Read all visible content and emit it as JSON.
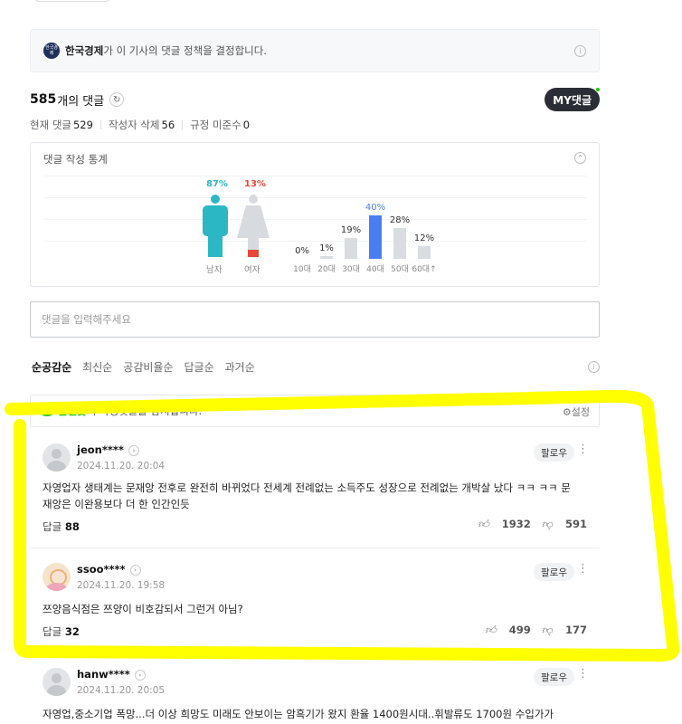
{
  "policy": {
    "press_logo_text": "한국경제",
    "press_name": "한국경제",
    "text": "가 이 기사의 댓글 정책을 결정합니다."
  },
  "comments_header": {
    "count": "585",
    "count_label": "개의 댓글",
    "my_button": "MY댓글",
    "current_label": "현재 댓글",
    "current_value": "529",
    "deleted_label": "작성자 삭제",
    "deleted_value": "56",
    "violation_label": "규정 미준수",
    "violation_value": "0"
  },
  "stats": {
    "title": "댓글 작성 통계",
    "gender": [
      {
        "label": "남자",
        "pct": "87%",
        "value": 87,
        "color": "#2bb7c4"
      },
      {
        "label": "여자",
        "pct": "13%",
        "value": 13,
        "color": "#e5493a"
      }
    ],
    "ages": [
      {
        "label": "10대",
        "pct": "0%",
        "value": 0
      },
      {
        "label": "20대",
        "pct": "1%",
        "value": 1
      },
      {
        "label": "30대",
        "pct": "19%",
        "value": 19
      },
      {
        "label": "40대",
        "pct": "40%",
        "value": 40
      },
      {
        "label": "50대",
        "pct": "28%",
        "value": 28
      },
      {
        "label": "60대↑",
        "pct": "12%",
        "value": 12
      }
    ],
    "age_highlight": "#4a7ef0"
  },
  "input": {
    "placeholder": "댓글을 입력해주세요"
  },
  "sort": {
    "tabs": [
      "순공감순",
      "최신순",
      "공감비율순",
      "답글순",
      "과거순"
    ]
  },
  "cleanbot": {
    "name": "클린봇",
    "text": "이 악성댓글을 감지합니다.",
    "setting": "설정"
  },
  "comment_list": [
    {
      "nick": "jeon****",
      "date": "2024.11.20. 20:04",
      "text": "자영업자 생태계는 문재앙 전후로 완전히 바뀌었다 전세계 전례없는 소득주도 성장으로 전례없는 개박살 났다 ㅋㅋ ㅋㅋ 문재앙은 이완용보다 더 한 인간인듯",
      "follow": "팔로우",
      "reply_label": "답글",
      "reply_count": "88",
      "likes": "1932",
      "dislikes": "591"
    },
    {
      "nick": "ssoo****",
      "date": "2024.11.20. 19:58",
      "text": "쯔양음식점은 쯔양이 비호감되서 그런거 아님?",
      "follow": "팔로우",
      "reply_label": "답글",
      "reply_count": "32",
      "likes": "499",
      "dislikes": "177"
    },
    {
      "nick": "hanw****",
      "date": "2024.11.20. 20:05",
      "text": "자영업,중소기업 폭망...더 이상 희망도 미래도 안보이는 암흑기가 왔지 환율 1400원시대..휘발류도 1700원 수입가가",
      "follow": "팔로우"
    }
  ]
}
